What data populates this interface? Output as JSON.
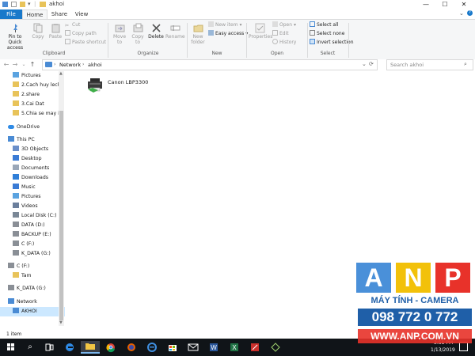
{
  "window": {
    "title": "akhoi",
    "min_label": "—",
    "max_label": "☐",
    "close_label": "✕"
  },
  "tabs": {
    "file": "File",
    "home": "Home",
    "share": "Share",
    "view": "View"
  },
  "ribbon": {
    "clipboard": {
      "pin_label": "Pin to Quick access",
      "copy_label": "Copy",
      "paste_label": "Paste",
      "cut_label": "Cut",
      "copy_path_label": "Copy path",
      "paste_shortcut_label": "Paste shortcut",
      "group_label": "Clipboard"
    },
    "organize": {
      "move_to_label": "Move to",
      "copy_to_label": "Copy to",
      "delete_label": "Delete",
      "rename_label": "Rename",
      "group_label": "Organize"
    },
    "new": {
      "new_folder_label": "New folder",
      "new_item_label": "New item",
      "easy_access_label": "Easy access",
      "group_label": "New"
    },
    "open": {
      "properties_label": "Properties",
      "open_label": "Open",
      "edit_label": "Edit",
      "history_label": "History",
      "group_label": "Open"
    },
    "select": {
      "select_all_label": "Select all",
      "select_none_label": "Select none",
      "invert_label": "Invert selection",
      "group_label": "Select"
    }
  },
  "address": {
    "crumb1": "Network",
    "crumb2": "akhoi",
    "search_placeholder": "Search akhoi"
  },
  "nav_items": [
    {
      "label": "Pictures",
      "icon": "pictures-icon",
      "indent": 1
    },
    {
      "label": "2.Cach huy lech",
      "icon": "folder-icon",
      "indent": 1
    },
    {
      "label": "2.share",
      "icon": "folder-icon",
      "indent": 1
    },
    {
      "label": "3.Cai Dat",
      "icon": "folder-icon",
      "indent": 1
    },
    {
      "label": "5.Chia se may in",
      "icon": "folder-icon",
      "indent": 1
    },
    {
      "label": "OneDrive",
      "icon": "onedrive-icon",
      "indent": 0
    },
    {
      "label": "This PC",
      "icon": "pc-icon",
      "indent": 0
    },
    {
      "label": "3D Objects",
      "icon": "3d-objects-icon",
      "indent": 1
    },
    {
      "label": "Desktop",
      "icon": "desktop-icon",
      "indent": 1
    },
    {
      "label": "Documents",
      "icon": "documents-icon",
      "indent": 1
    },
    {
      "label": "Downloads",
      "icon": "downloads-icon",
      "indent": 1
    },
    {
      "label": "Music",
      "icon": "music-icon",
      "indent": 1
    },
    {
      "label": "Pictures",
      "icon": "pictures-icon",
      "indent": 1
    },
    {
      "label": "Videos",
      "icon": "videos-icon",
      "indent": 1
    },
    {
      "label": "Local Disk (C:)",
      "icon": "disk-icon",
      "indent": 1
    },
    {
      "label": "DATA (D:)",
      "icon": "drive-icon",
      "indent": 1
    },
    {
      "label": "BACKUP (E:)",
      "icon": "drive-icon",
      "indent": 1
    },
    {
      "label": "C (F:)",
      "icon": "drive-icon",
      "indent": 1
    },
    {
      "label": "K_DATA (G:)",
      "icon": "drive-icon",
      "indent": 1
    },
    {
      "label": "C (F:)",
      "icon": "drive-icon",
      "indent": 0
    },
    {
      "label": "Tam",
      "icon": "folder-icon",
      "indent": 1
    },
    {
      "label": "K_DATA (G:)",
      "icon": "drive-icon",
      "indent": 0
    },
    {
      "label": "Network",
      "icon": "network-icon",
      "indent": 0
    },
    {
      "label": "AKHOI",
      "icon": "computer-icon",
      "indent": 1
    }
  ],
  "content": {
    "items": [
      {
        "label": "Canon LBP3300",
        "icon": "printer-icon"
      }
    ]
  },
  "status": {
    "count": "1 item"
  },
  "taskbar": {
    "time": "3:51 PM",
    "date": "1/13/2019"
  },
  "watermark": {
    "letters": [
      "A",
      "N",
      "P"
    ],
    "line1": "MÁY TÍNH - CAMERA",
    "phone": "098 772 0 772",
    "site": "WWW.ANP.COM.VN"
  },
  "colors": {
    "accent": "#1979ca",
    "ribbon_bg": "#f5f6f7",
    "selection": "#cce8ff",
    "taskbar": "#101418",
    "wm_blue": "#4a90d9",
    "wm_yellow": "#f2c10a",
    "wm_red": "#e8322a"
  }
}
